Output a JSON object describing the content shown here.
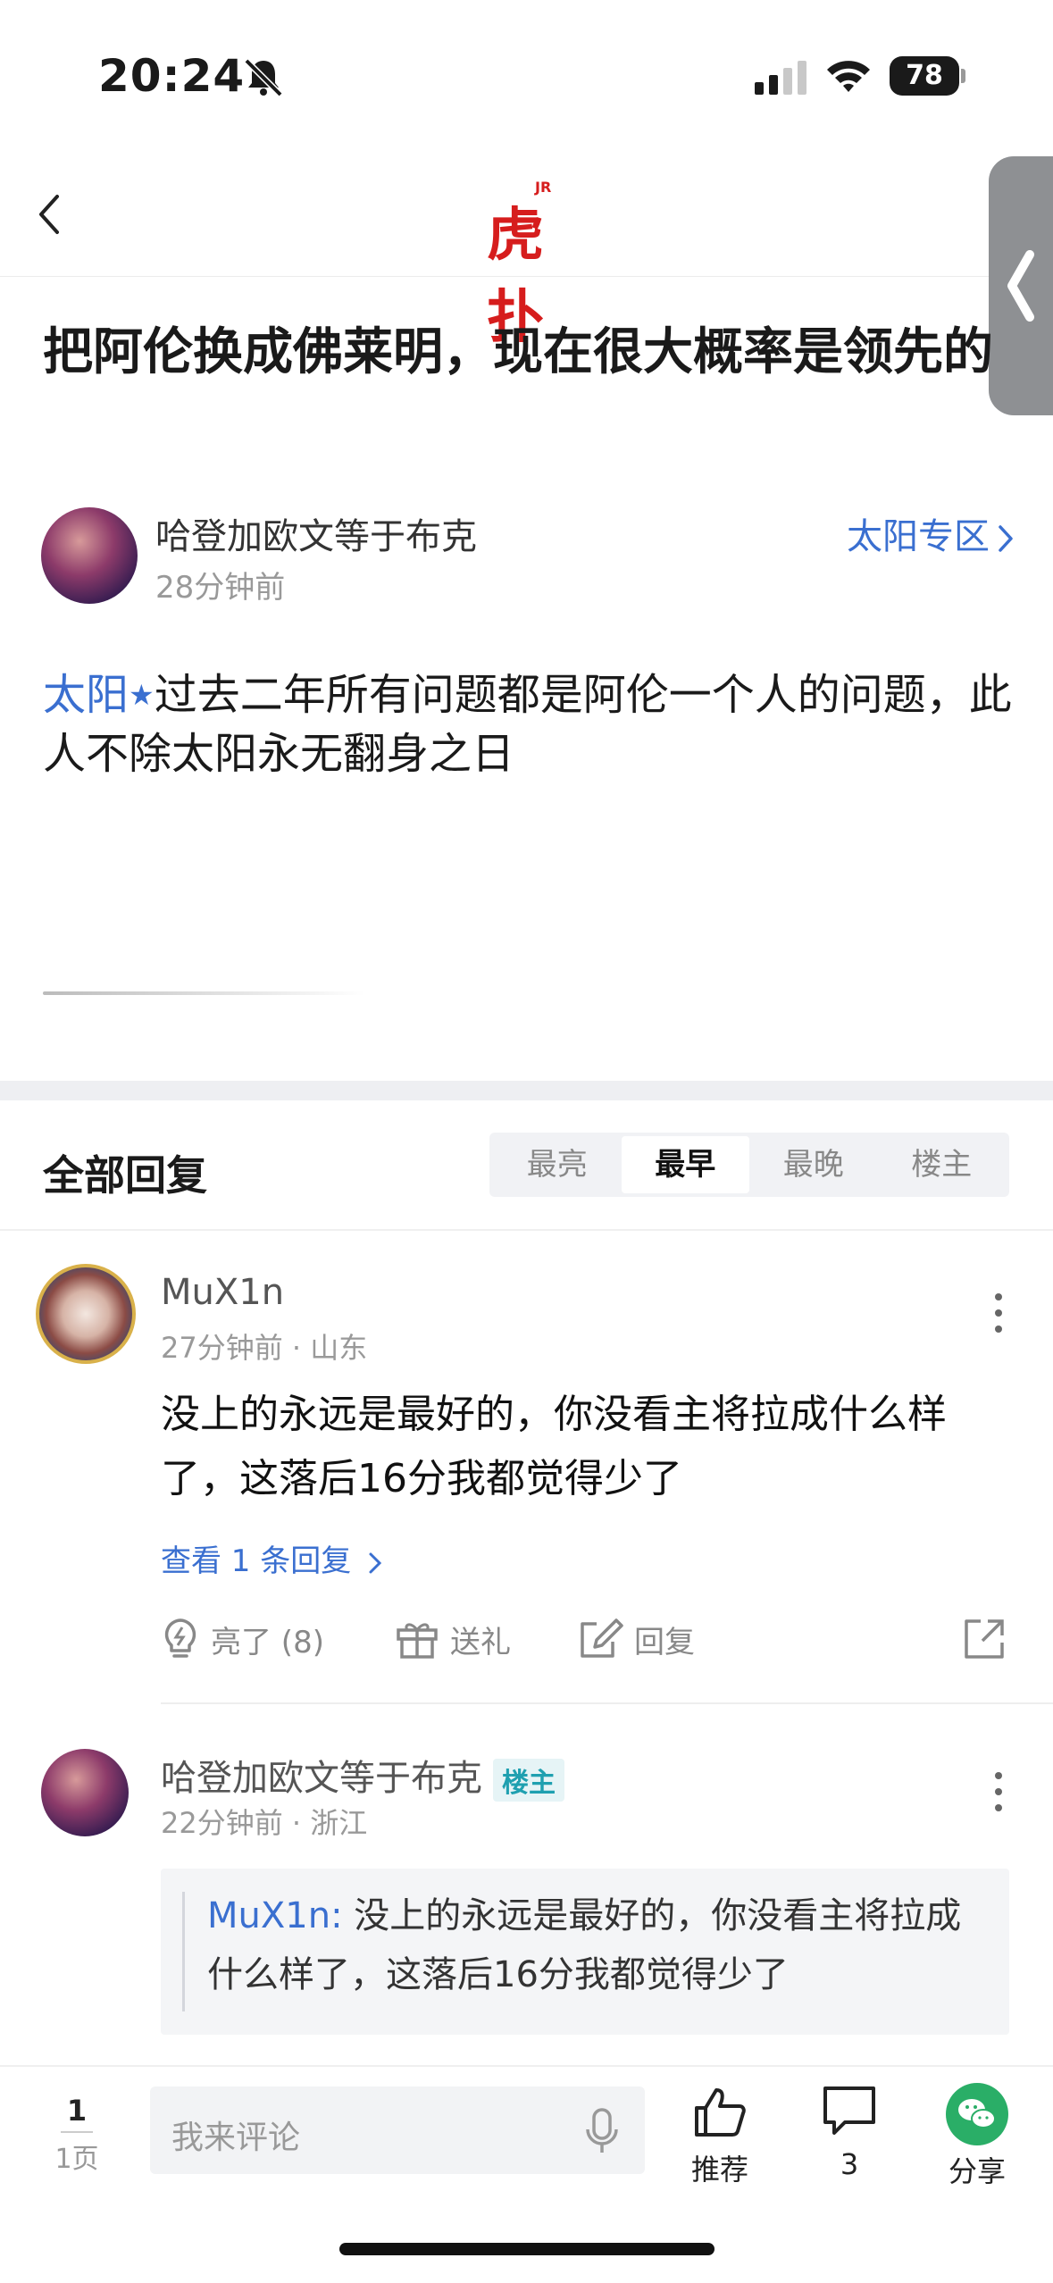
{
  "status_bar": {
    "time": "20:24",
    "battery": "78"
  },
  "nav": {
    "logo_text": "虎扑",
    "logo_badge": "JR"
  },
  "post": {
    "title": "把阿伦换成佛莱明，现在很大概率是领先的",
    "author": "哈登加欧文等于布克",
    "time": "28分钟前",
    "zone": "太阳专区",
    "tag": "太阳",
    "body": "过去二年所有问题都是阿伦一个人的问题，此人不除太阳永无翻身之日"
  },
  "replies": {
    "title": "全部回复",
    "sort_tabs": [
      "最亮",
      "最早",
      "最晚",
      "楼主"
    ],
    "active_tab": "最早"
  },
  "comments": [
    {
      "user": "MuX1n",
      "meta": "27分钟前 · 山东",
      "text": "没上的永远是最好的，你没看主将拉成什么样了，这落后16分我都觉得少了",
      "view_replies": "查看 1 条回复",
      "actions": {
        "like": "亮了 (8)",
        "gift": "送礼",
        "reply": "回复"
      }
    },
    {
      "user": "哈登加欧文等于布克",
      "badge": "楼主",
      "meta": "22分钟前 · 浙江",
      "quote_user": "MuX1n:",
      "quote_text": "没上的永远是最好的，你没看主将拉成什么样了，这落后16分我都觉得少了"
    }
  ],
  "bottom_bar": {
    "page_current": "1",
    "page_label": "1页",
    "input_placeholder": "我来评论",
    "recommend": "推荐",
    "comments_count": "3",
    "share": "分享"
  }
}
